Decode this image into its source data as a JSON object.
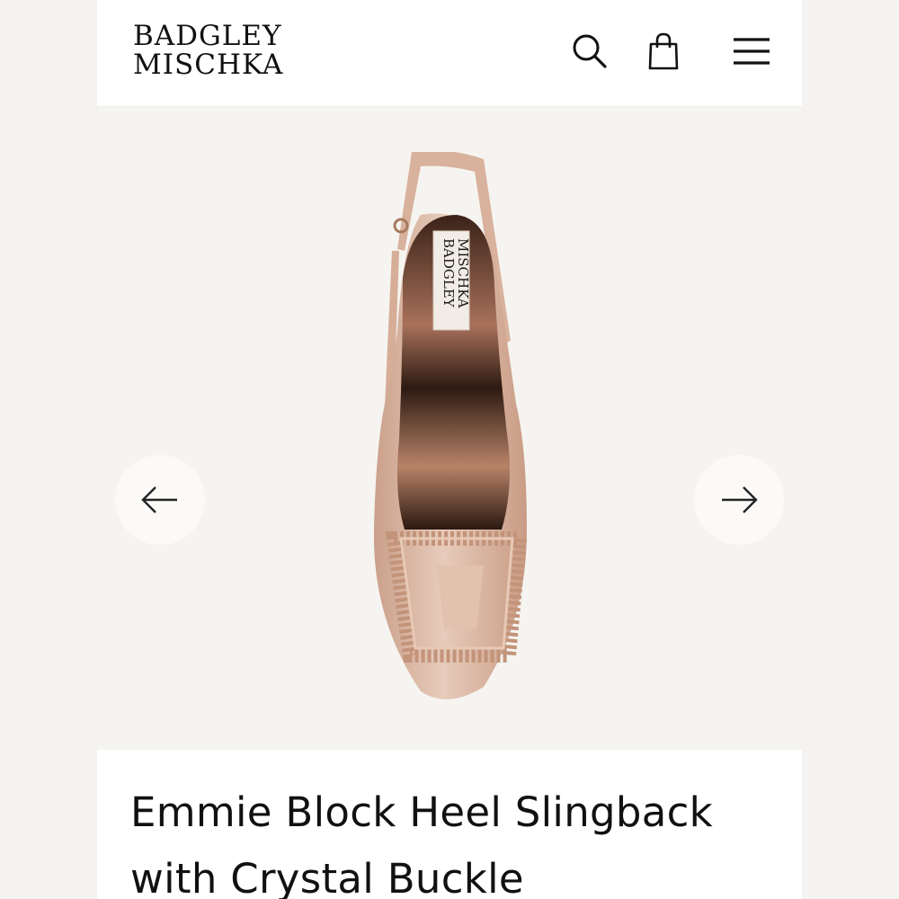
{
  "brand": {
    "line1": "BADGLEY",
    "line2": "MISCHKA"
  },
  "header_icons": [
    "search-icon",
    "shopping-bag-icon",
    "hamburger-menu-icon"
  ],
  "gallery": {
    "prev_icon": "arrow-left-icon",
    "next_icon": "arrow-right-icon",
    "insole_label_line1": "BADGLEY",
    "insole_label_line2": "MISCHKA"
  },
  "product": {
    "title": "Emmie Block Heel Slingback with Crystal Buckle"
  },
  "colors": {
    "background": "#f4f3f1",
    "panel": "#ffffff",
    "gallery_bg": "#f6f4f1",
    "text": "#111111",
    "shoe_satin": "#d9b5a0",
    "crystal": "#c99a7d"
  }
}
